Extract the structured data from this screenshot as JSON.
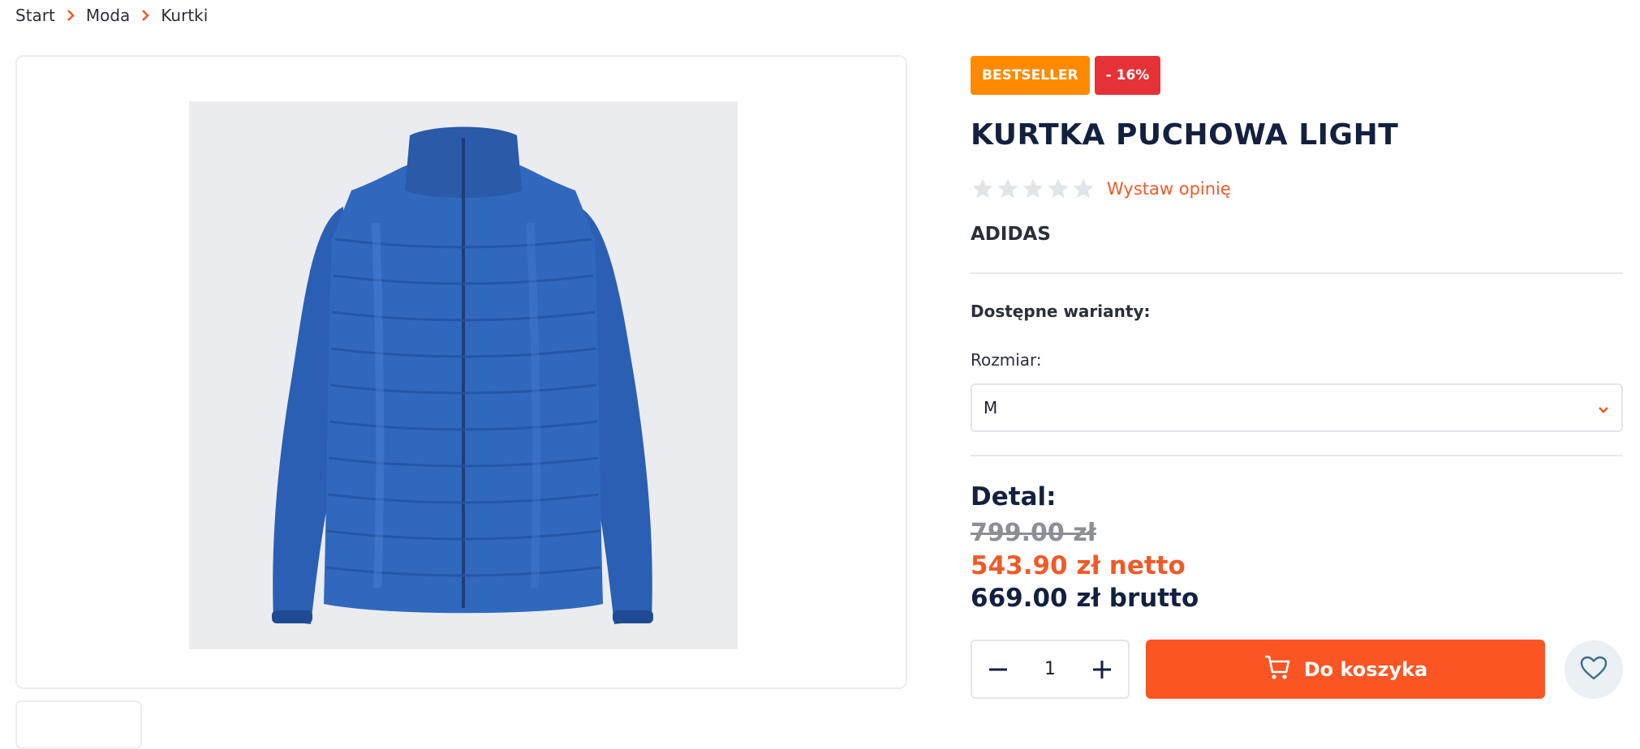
{
  "breadcrumb": {
    "items": [
      "Start",
      "Moda",
      "Kurtki"
    ]
  },
  "product": {
    "badges": {
      "bestseller": "BESTSELLER",
      "discount": "- 16%"
    },
    "title": "KURTKA PUCHOWA LIGHT",
    "rating": {
      "value": 0,
      "max": 5,
      "review_link": "Wystaw opinię"
    },
    "brand": "ADIDAS",
    "variants": {
      "heading": "Dostępne warianty:",
      "size_label": "Rozmiar:",
      "size_selected": "M"
    },
    "price": {
      "label": "Detal:",
      "old": "799.00 zł",
      "net": "543.90 zł netto",
      "gross": "669.00 zł brutto"
    },
    "quantity": "1",
    "add_to_cart_label": "Do koszyka",
    "image_alt": "blue quilted down jacket"
  },
  "colors": {
    "accent": "#fb5523",
    "bestseller": "#ff8a00",
    "discount": "#e63236",
    "navy": "#13213f",
    "jacket": "#2f63b8"
  },
  "icons": [
    "chevron-right-icon",
    "star-icon",
    "chevron-down-icon",
    "minus-icon",
    "plus-icon",
    "cart-icon",
    "heart-icon"
  ]
}
